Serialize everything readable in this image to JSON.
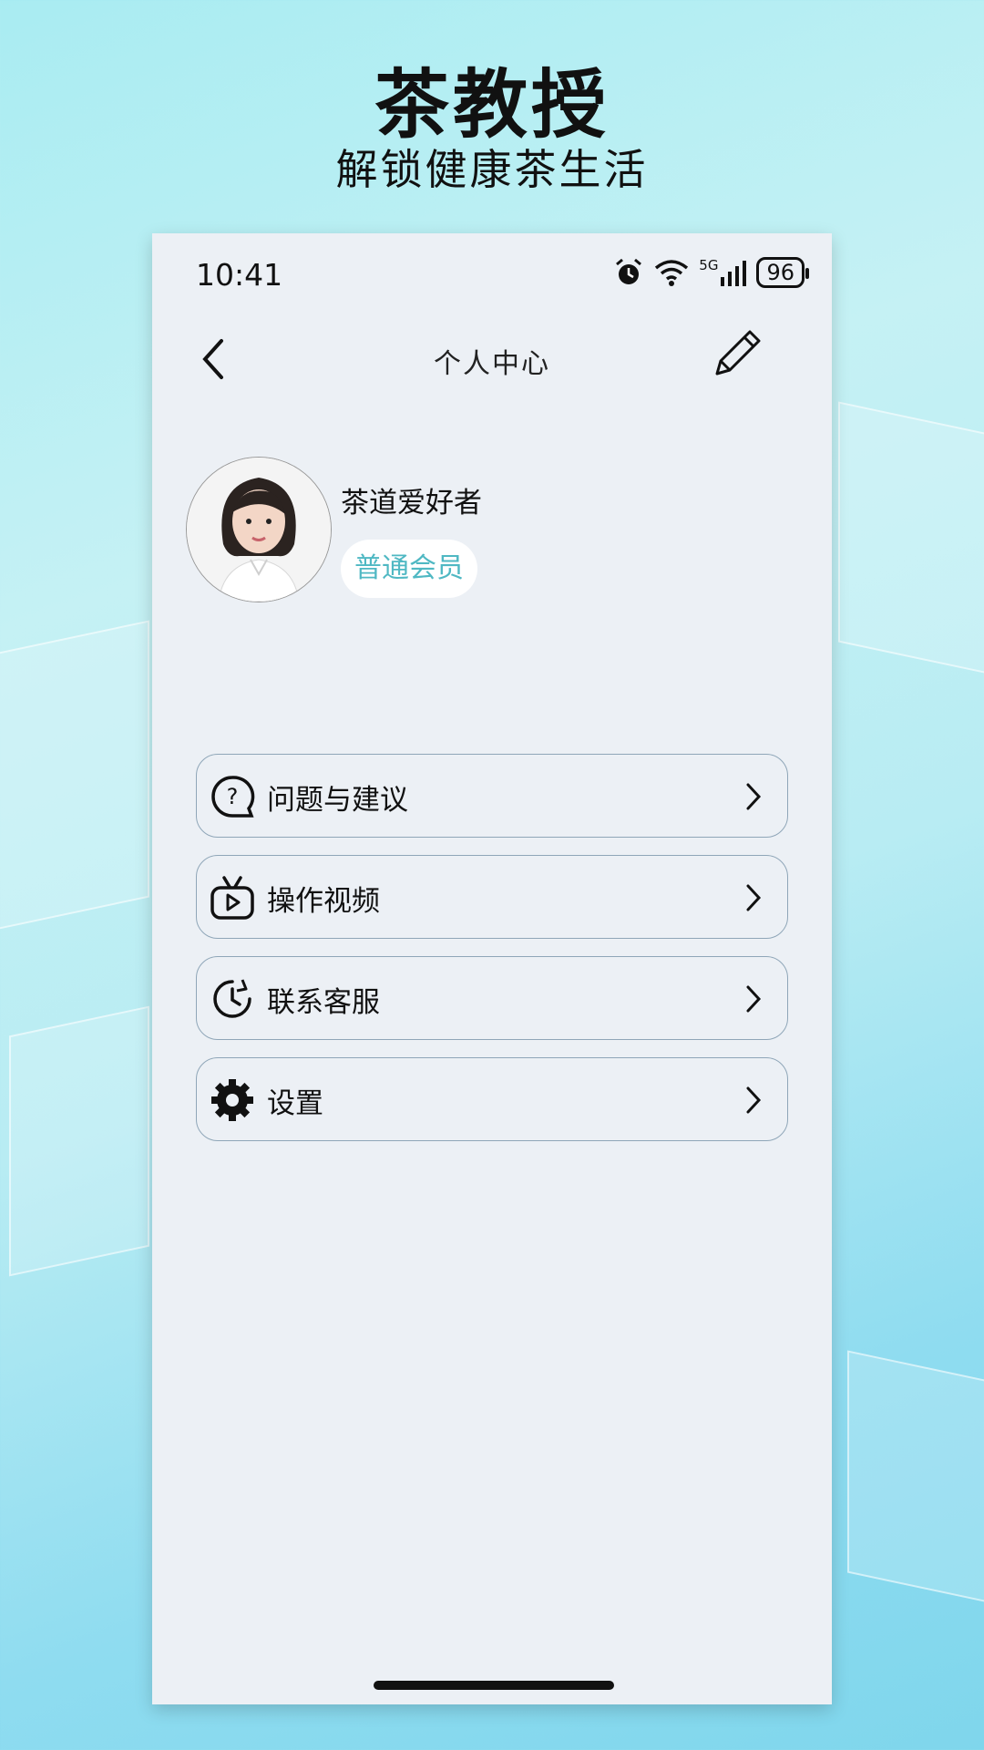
{
  "promo": {
    "title": "茶教授",
    "subtitle": "解锁健康茶生活"
  },
  "status_bar": {
    "time": "10:41",
    "network": "5G",
    "battery": "96"
  },
  "nav": {
    "title": "个人中心",
    "back_icon": "chevron-left-icon",
    "edit_icon": "pencil-icon"
  },
  "profile": {
    "name": "茶道爱好者",
    "badge": "普通会员"
  },
  "menu": [
    {
      "label": "问题与建议",
      "icon": "question-bubble-icon"
    },
    {
      "label": "操作视频",
      "icon": "video-tv-icon"
    },
    {
      "label": "联系客服",
      "icon": "clock-arrow-icon"
    },
    {
      "label": "设置",
      "icon": "gear-icon"
    }
  ],
  "colors": {
    "badge_text": "#4fb8c3",
    "panel_bg": "#ecf0f5",
    "item_border": "#8fa6b8"
  }
}
